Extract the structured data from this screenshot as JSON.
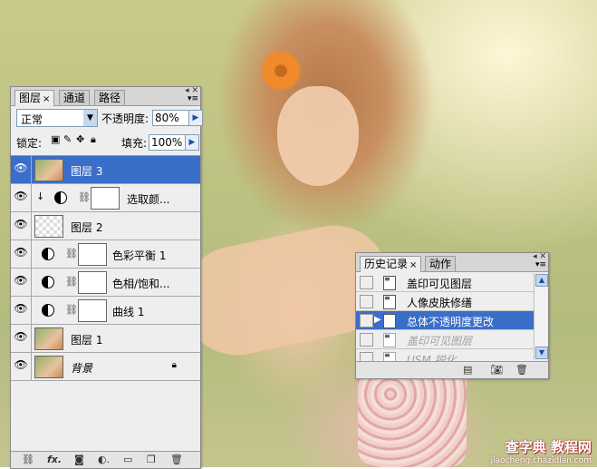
{
  "layers_panel": {
    "tabs": [
      {
        "label": "图层",
        "close": "×"
      },
      {
        "label": "通道"
      },
      {
        "label": "路径"
      }
    ],
    "blend_mode": "正常",
    "opacity_label": "不透明度:",
    "opacity_value": "80%",
    "lock_label": "锁定:",
    "fill_label": "填充:",
    "fill_value": "100%",
    "layers": [
      {
        "name": "图层 3",
        "selected": true
      },
      {
        "name": "选取颜..."
      },
      {
        "name": "图层 2"
      },
      {
        "name": "色彩平衡 1"
      },
      {
        "name": "色相/饱和..."
      },
      {
        "name": "曲线 1"
      },
      {
        "name": "图层 1"
      },
      {
        "name": "背景"
      }
    ]
  },
  "history_panel": {
    "tabs": [
      {
        "label": "历史记录",
        "close": "×"
      },
      {
        "label": "动作"
      }
    ],
    "items": [
      {
        "name": "盖印可见图层"
      },
      {
        "name": "人像皮肤修缮"
      },
      {
        "name": "总体不透明度更改",
        "selected": true
      },
      {
        "name": "盖印可见图层",
        "dimmed": true
      },
      {
        "name": "USM 锐化",
        "dimmed": true
      }
    ]
  },
  "watermark": {
    "main": "查字典 教程网",
    "sub": "jiaocheng.chazidian.com"
  }
}
